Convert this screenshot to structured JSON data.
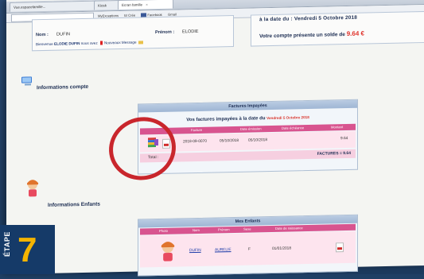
{
  "browser": {
    "tabs": [
      {
        "label": "Vue.espacefamille..."
      },
      {
        "label": "Kiosk"
      },
      {
        "label": "Ecran famille"
      }
    ],
    "bookmarks": [
      "MyExceptions",
      "El Crée",
      "Facebook",
      "Gmail"
    ]
  },
  "account": {
    "nom_label": "Nom :",
    "nom_value": "DUFIN",
    "prenom_label": "Prénom :",
    "prenom_value": "ELODIE",
    "welcome_prefix": "Bienvenue",
    "welcome_name": "ELODIE DUFIN",
    "welcome_suffix": "nous avez",
    "messages_link": "Nouveaux Message"
  },
  "balance": {
    "date_line": "à la date du : Vendredi 5 Octobre 2018",
    "balance_prefix": "Votre compte présente un solde de",
    "balance_amount": "9.64 €"
  },
  "sections": {
    "account_info": "Informations compte",
    "children_info": "Informations Enfants"
  },
  "invoices": {
    "panel_title": "Factures Impayées",
    "heading_prefix": "Vos factures impayées à la date du",
    "heading_date": "Vendredi 5 Octobre 2018",
    "columns": [
      "Facture",
      "Date émission",
      "Date échéance",
      "Montant"
    ],
    "row": {
      "number": "2018-09-0070",
      "issue_date": "05/10/2018",
      "due_date": "05/10/2018",
      "amount": "9.64"
    },
    "total_label": "Total :",
    "total_amount": "FACTURES = 9.64"
  },
  "children": {
    "panel_title": "Mes Enfants",
    "columns": [
      "Photo",
      "Nom",
      "Prénom",
      "Sexe",
      "Date de naissance"
    ],
    "row": {
      "nom": "DUFIN",
      "prenom": "AURELIE",
      "sexe": "F",
      "naissance": "01/01/2018"
    }
  },
  "step": {
    "word": "ÉTAPE",
    "number": "7"
  },
  "colors": {
    "accent_pink": "#d8548f",
    "amount_red": "#e0342c",
    "navy_text": "#1c2d52",
    "highlight_ring": "#c9262c",
    "step_number": "#f4b400"
  }
}
